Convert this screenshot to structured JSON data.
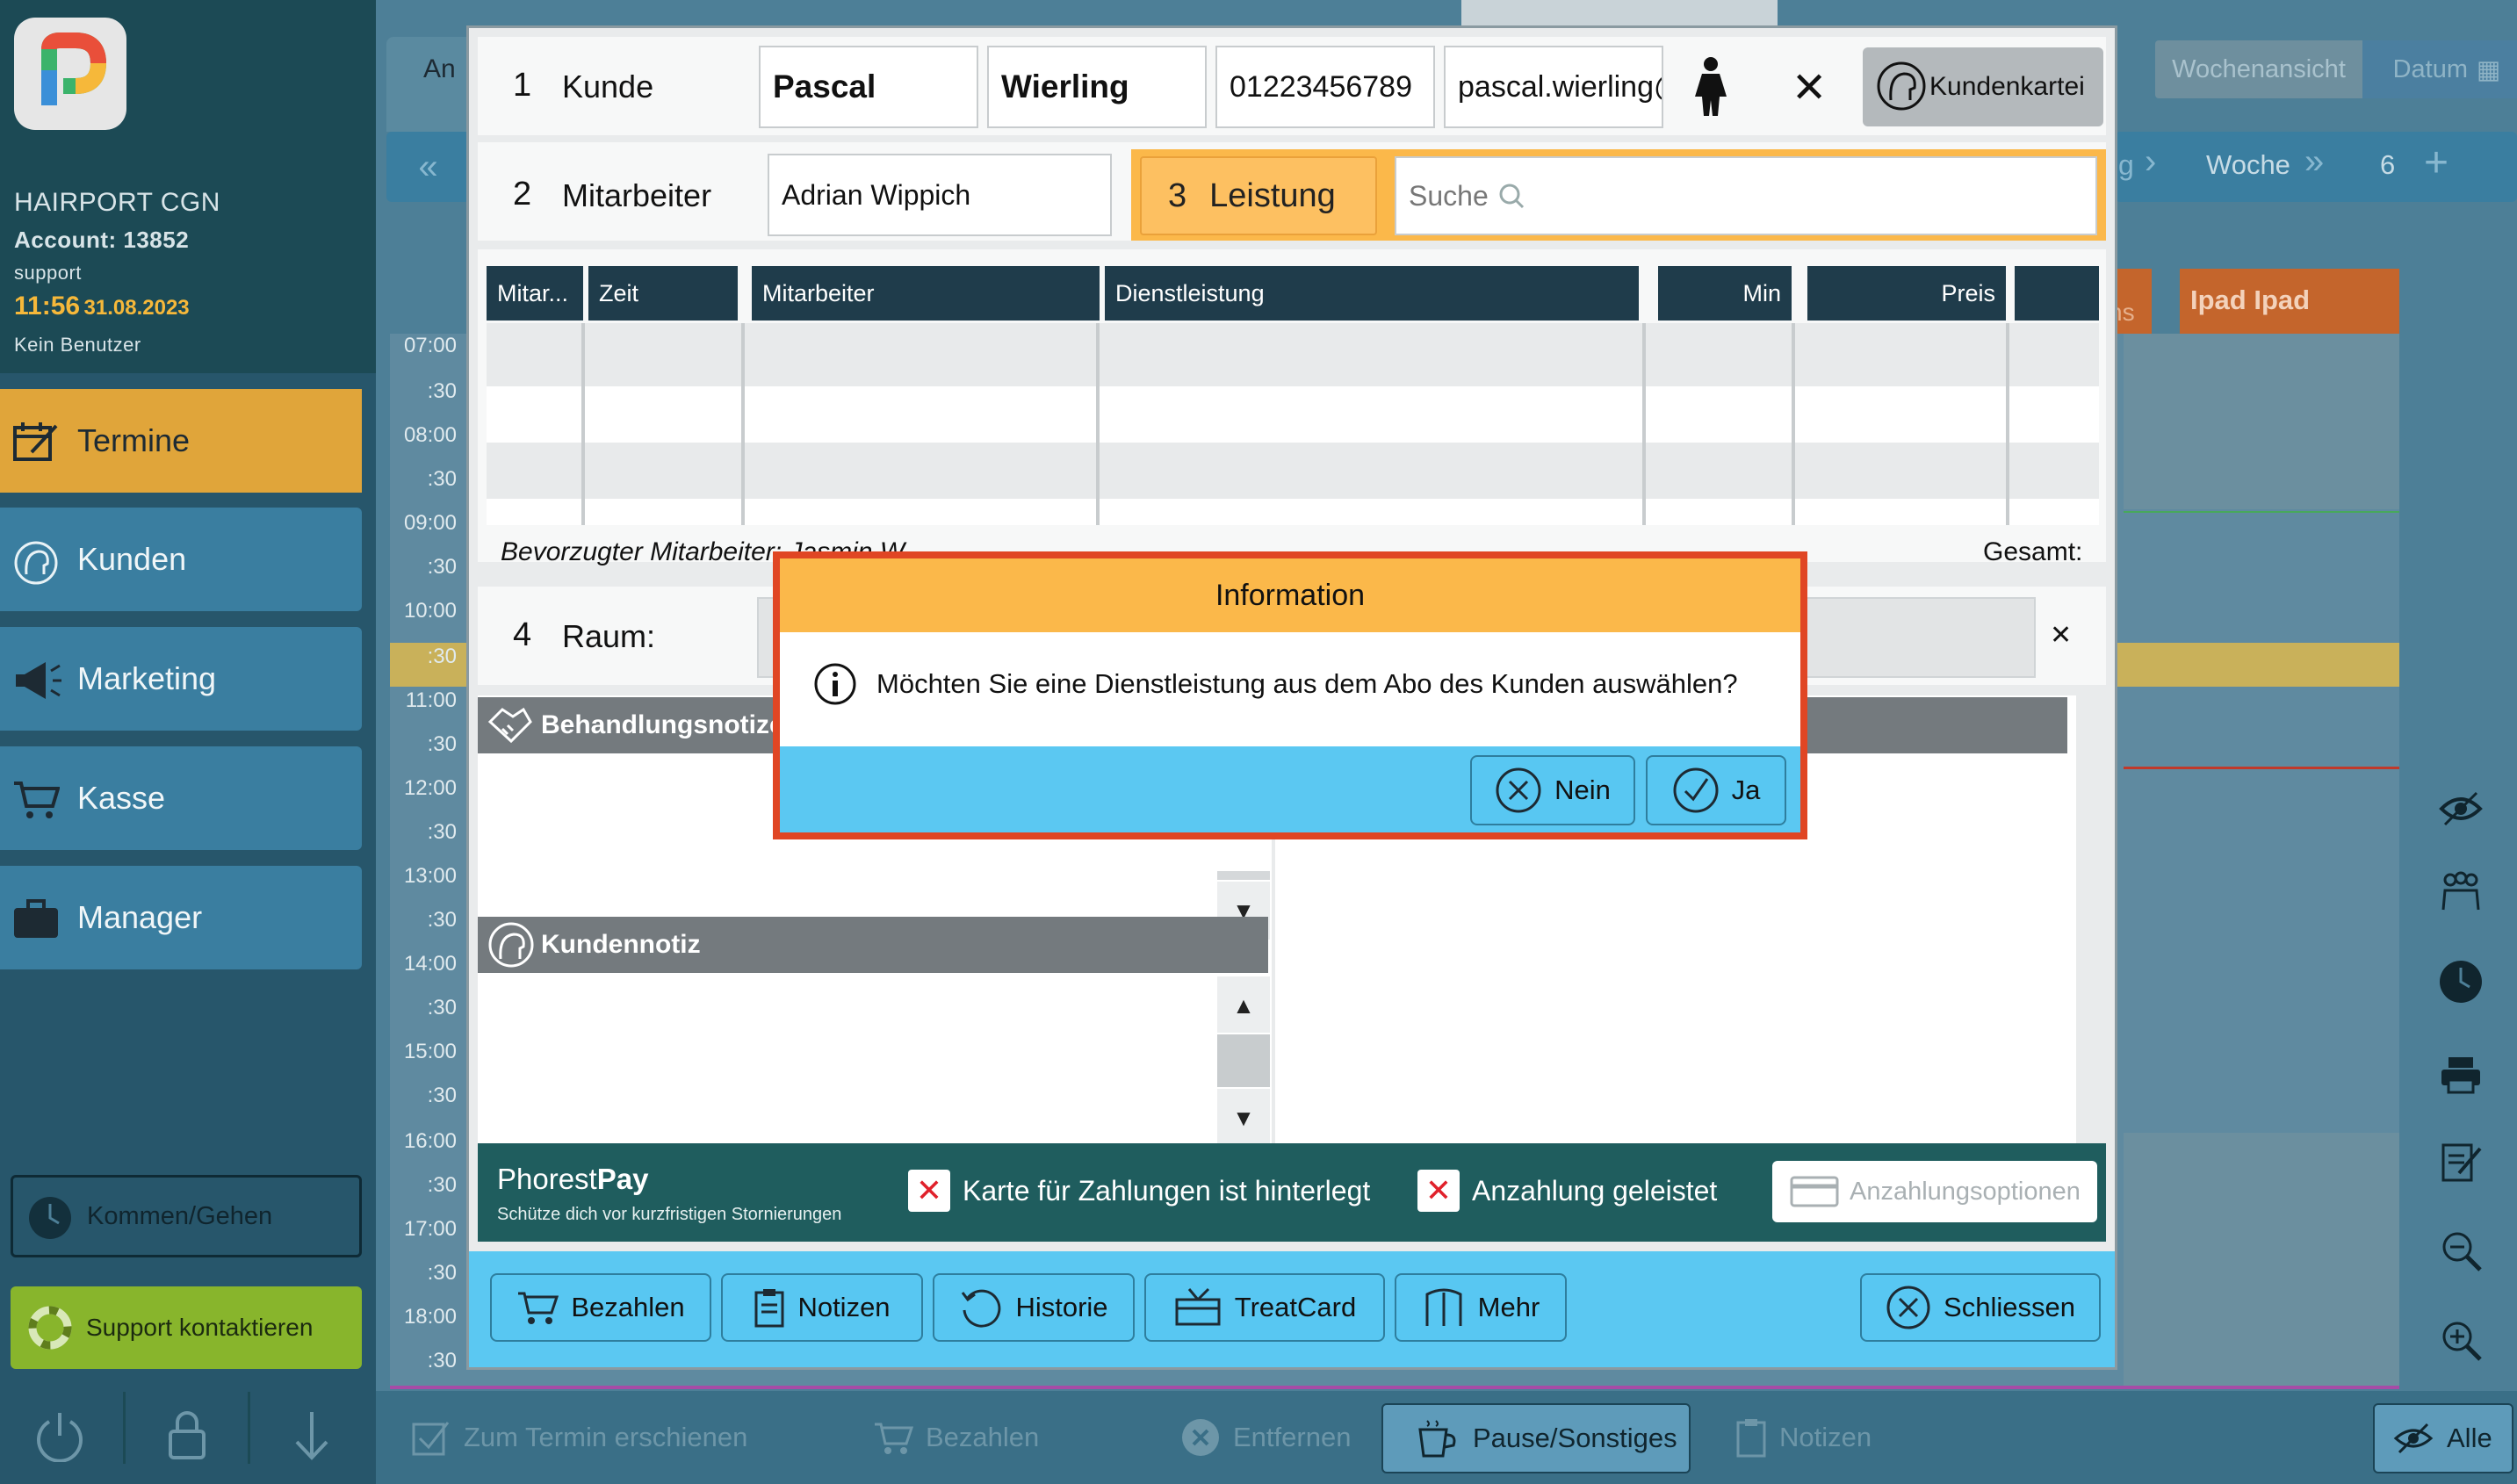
{
  "sidebar": {
    "salon": "HAIRPORT CGN",
    "account": "Account: 13852",
    "user": "support",
    "time": "11:56",
    "date": "31.08.2023",
    "status": "Kein Benutzer",
    "nav": [
      {
        "label": "Termine",
        "icon": "calendar-edit-icon",
        "active": true
      },
      {
        "label": "Kunden",
        "icon": "customer-head-icon"
      },
      {
        "label": "Marketing",
        "icon": "megaphone-icon"
      },
      {
        "label": "Kasse",
        "icon": "cart-icon"
      },
      {
        "label": "Manager",
        "icon": "briefcase-icon"
      }
    ],
    "kommen_gehen": "Kommen/Gehen",
    "support": "Support kontaktieren"
  },
  "calendar": {
    "view_week": "Wochenansicht",
    "view_date": "Datum",
    "nav_week": "Woche",
    "nav_count": "6",
    "column_header": "Ipad Ipad",
    "partial_header_left": "An",
    "partial_header_right": "ns",
    "partial_nav": "g",
    "times": [
      "07:00",
      ":30",
      "08:00",
      ":30",
      "09:00",
      ":30",
      "10:00",
      ":30",
      "11:00",
      ":30",
      "12:00",
      ":30",
      "13:00",
      ":30",
      "14:00",
      ":30",
      "15:00",
      ":30",
      "16:00",
      ":30",
      "17:00",
      ":30",
      "18:00",
      ":30"
    ]
  },
  "modal": {
    "row1": {
      "num": "1",
      "label": "Kunde",
      "firstname": "Pascal",
      "lastname": "Wierling",
      "phone": "01223456789",
      "email": "pascal.wierling@",
      "customer_card": "Kundenkartei"
    },
    "row2": {
      "num": "2",
      "label": "Mitarbeiter",
      "employee": "Adrian Wippich"
    },
    "row3": {
      "num": "3",
      "label": "Leistung",
      "search_placeholder": "Suche"
    },
    "table": {
      "headers": [
        "Mitar...",
        "Zeit",
        "Mitarbeiter",
        "Dienstleistung",
        "Min",
        "Preis",
        ""
      ]
    },
    "preferred": "Bevorzugter Mitarbeiter: Jasmin W.",
    "total": "Gesamt:",
    "row4": {
      "num": "4",
      "label": "Raum:"
    },
    "treatment_notes": "Behandlungsnotize",
    "customer_notes": "Kundennotiz",
    "phorest": {
      "brand_a": "Phorest",
      "brand_b": "Pay",
      "tagline": "Schütze dich vor kurzfristigen Stornierungen",
      "card_saved": "Karte für Zahlungen ist hinterlegt",
      "deposit": "Anzahlung geleistet",
      "deposit_options": "Anzahlungsoptionen"
    },
    "actions": [
      "Bezahlen",
      "Notizen",
      "Historie",
      "TreatCard",
      "Mehr"
    ],
    "close": "Schliessen"
  },
  "dialog": {
    "title": "Information",
    "message": "Möchten Sie eine Dienstleistung aus dem Abo des Kunden auswählen?",
    "no": "Nein",
    "yes": "Ja"
  },
  "bottombar": {
    "appeared": "Zum Termin erschienen",
    "pay": "Bezahlen",
    "remove": "Entfernen",
    "pause": "Pause/Sonstiges",
    "notes": "Notizen",
    "all": "Alle"
  },
  "colors": {
    "sidebar_head": "#1c4a55",
    "active_nav": "#e0a53a",
    "nav": "#3a7ea0",
    "dialog_title": "#fbb84a",
    "dialog_border": "#e04624",
    "button_blue": "#58c7f2",
    "table_header": "#1f3c4b",
    "highlight_orange": "#fbb84a"
  }
}
